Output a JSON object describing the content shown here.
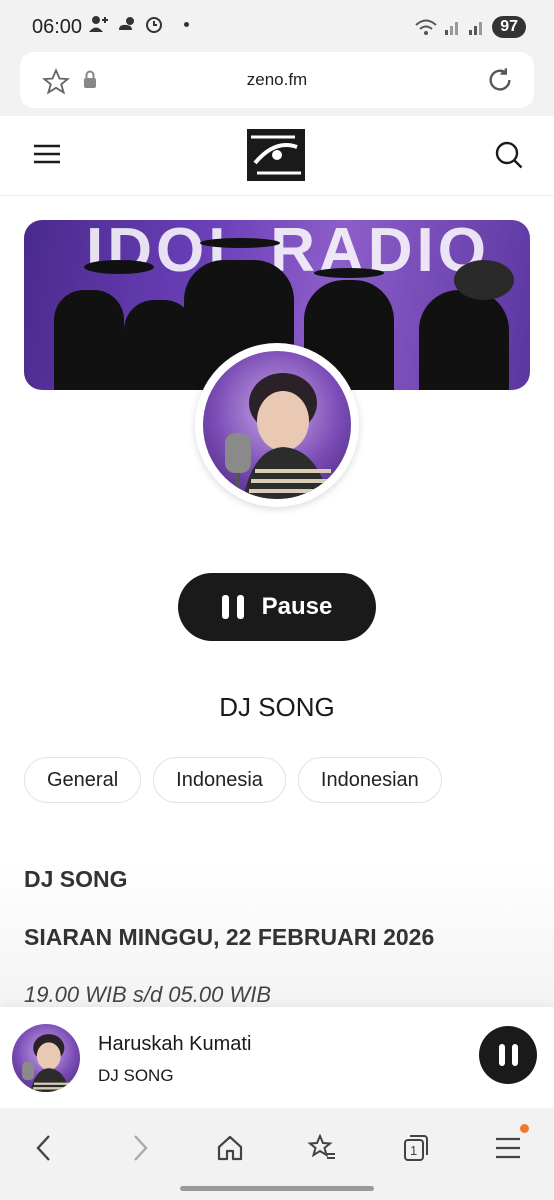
{
  "status_bar": {
    "time": "06:00",
    "battery": "97"
  },
  "browser": {
    "url": "zeno.fm"
  },
  "player": {
    "pause_label": "Pause",
    "station_name": "DJ SONG",
    "tags": [
      "General",
      "Indonesia",
      "Indonesian"
    ],
    "description": {
      "title": "DJ SONG",
      "date": "SIARAN MINGGU, 22 FEBRUARI 2026",
      "time": "19.00 WIB s/d 05.00 WIB"
    }
  },
  "banner": {
    "text": "IDOL RADIO"
  },
  "mini_player": {
    "track_title": "Haruskah Kumati",
    "artist": "DJ SONG"
  },
  "bottom_nav": {
    "tab_count": "1"
  },
  "colors": {
    "dark": "#1a1a1a",
    "banner_purple": "#6a3fb8",
    "notification": "#f07a2a"
  }
}
